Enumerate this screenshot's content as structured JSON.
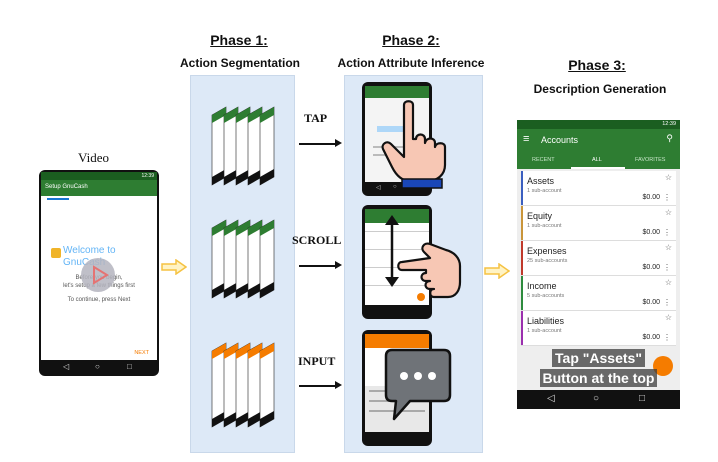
{
  "phases": [
    {
      "title": "Phase 1:",
      "subtitle": "Action Segmentation"
    },
    {
      "title": "Phase 2:",
      "subtitle": "Action Attribute Inference"
    },
    {
      "title": "Phase 3:",
      "subtitle": "Description Generation"
    }
  ],
  "video": {
    "label": "Video",
    "app_bar": "Setup GnuCash",
    "status_time": "12:39",
    "welcome": "Welcome to GnuCash",
    "line1": "Before you begin,",
    "line2": "let's setup a few things first",
    "line3": "To continue, press Next",
    "next": "NEXT"
  },
  "actions": [
    {
      "label": "TAP"
    },
    {
      "label": "SCROLL"
    },
    {
      "label": "INPUT"
    }
  ],
  "phase3": {
    "status_time": "12:39",
    "title": "Accounts",
    "tabs": [
      "RECENT",
      "ALL",
      "FAVORITES"
    ],
    "accounts": [
      {
        "name": "Assets",
        "sub": "1 sub-account",
        "value": "$0.00",
        "color": "#3b5fc0"
      },
      {
        "name": "Equity",
        "sub": "1 sub-account",
        "value": "$0.00",
        "color": "#c9953a"
      },
      {
        "name": "Expenses",
        "sub": "25 sub-accounts",
        "value": "$0.00",
        "color": "#c0392b"
      },
      {
        "name": "Income",
        "sub": "5 sub-accounts",
        "value": "$0.00",
        "color": "#2e8b3e"
      },
      {
        "name": "Liabilities",
        "sub": "1 sub-account",
        "value": "$0.00",
        "color": "#9b2fae"
      }
    ],
    "caption_line1": "Tap \"Assets\"",
    "caption_line2": "Button at the top"
  },
  "colors": {
    "panel": "#dde9f7",
    "accent_green": "#2e7d32",
    "accent_orange": "#f57c00",
    "hand_skin": "#f7c7b4",
    "flow_arrow": "#f5c242"
  }
}
